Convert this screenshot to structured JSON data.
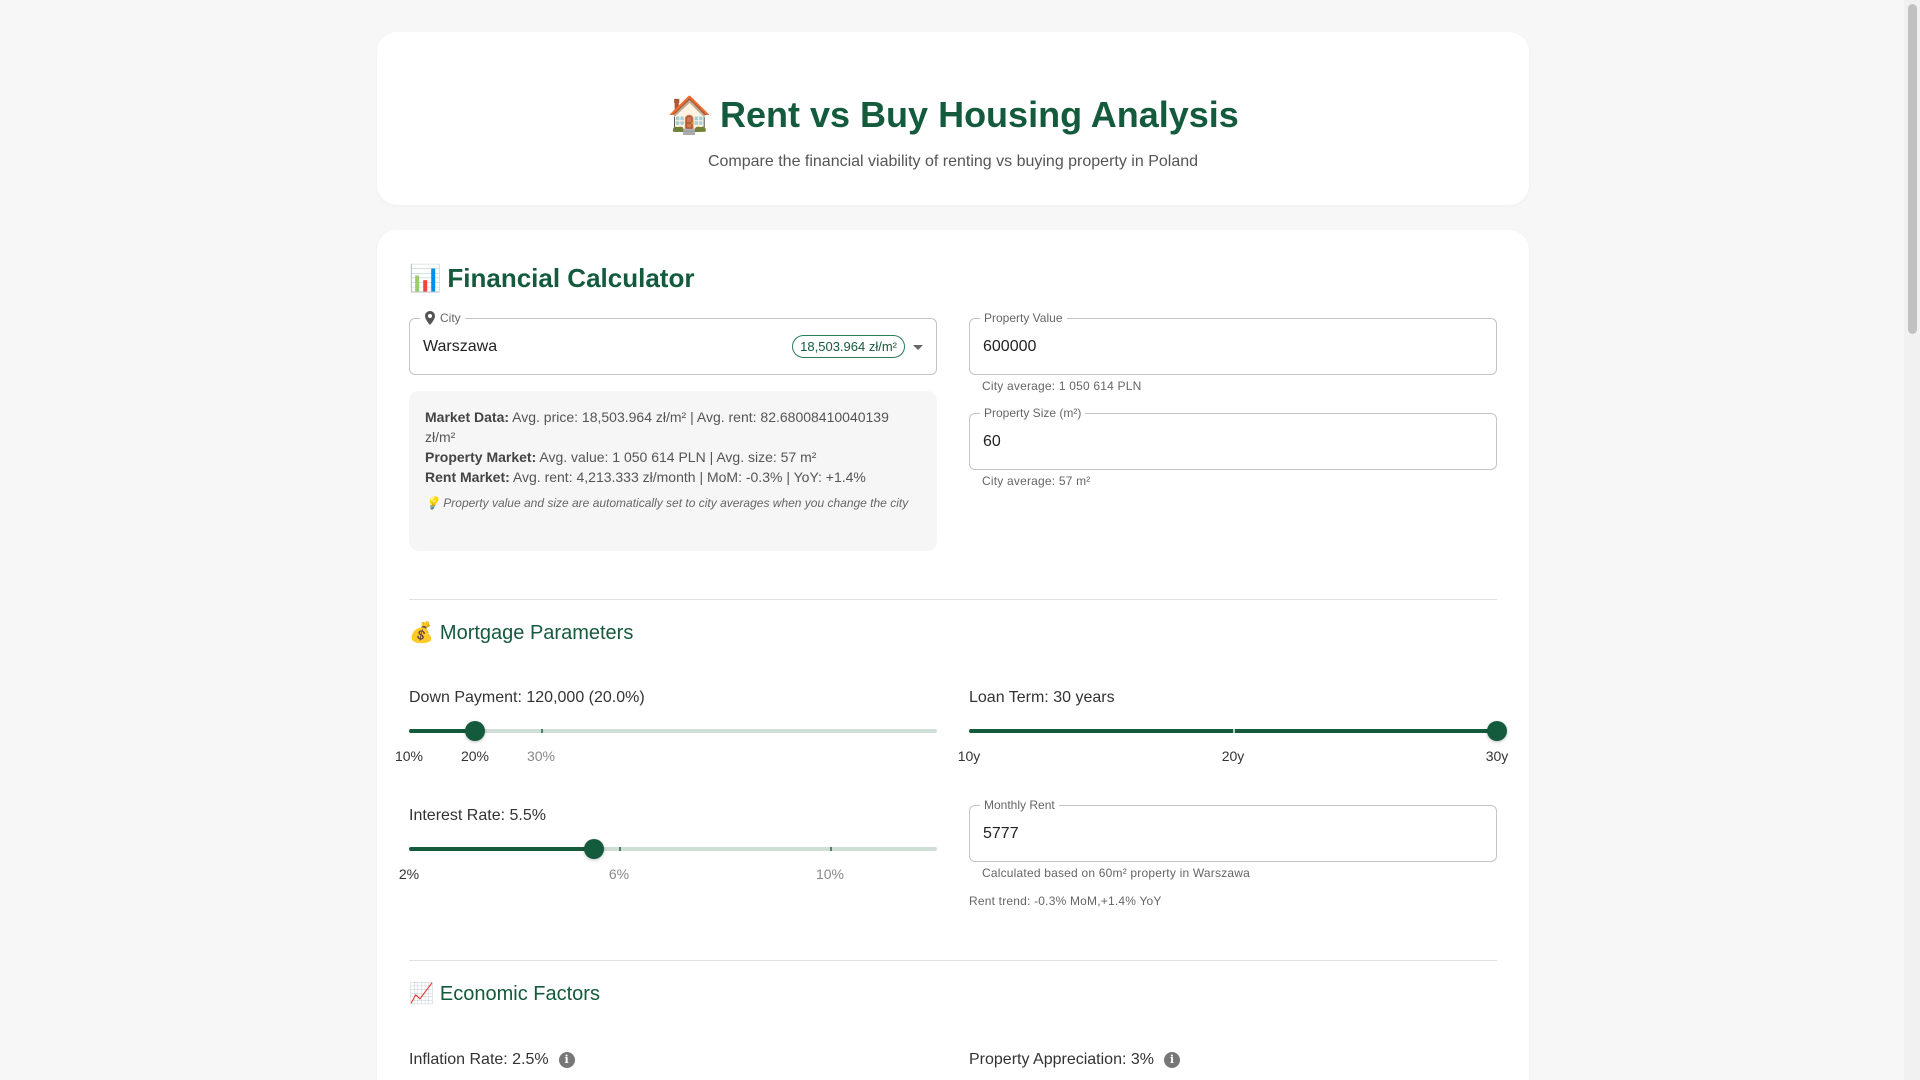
{
  "header": {
    "title_emoji": "🏠",
    "title": "Rent vs Buy Housing Analysis",
    "subtitle": "Compare the financial viability of renting vs buying property in Poland"
  },
  "calculator": {
    "title_emoji": "📊",
    "title": "Financial Calculator",
    "city": {
      "label": "City",
      "value": "Warszawa",
      "badge": "18,503.964 zł/m²"
    },
    "market": {
      "market_data_label": "Market Data:",
      "market_data_text": "Avg. price: 18,503.964 zł/m² | Avg. rent: 82.68008410040139 zł/m²",
      "property_market_label": "Property Market:",
      "property_market_text": "Avg. value: 1 050 614 PLN | Avg. size: 57 m²",
      "rent_market_label": "Rent Market:",
      "rent_market_text": "Avg. rent: 4,213.333 zł/month | MoM: -0.3% | YoY: +1.4%",
      "note": "💡 Property value and size are automatically set to city averages when you change the city"
    },
    "property_value": {
      "label": "Property Value",
      "value": "600000",
      "helper": "City average: 1 050 614 PLN"
    },
    "property_size": {
      "label": "Property Size (m²)",
      "value": "60",
      "helper": "City average: 57 m²"
    }
  },
  "mortgage": {
    "title_emoji": "💰",
    "title": "Mortgage Parameters",
    "down_payment": {
      "label": "Down Payment: 120,000 (20.0%)",
      "level_fraction": 0.125,
      "marks": [
        "10%",
        "20%",
        "30%"
      ]
    },
    "loan_term": {
      "label": "Loan Term: 30 years",
      "level_fraction": 1.0,
      "marks": [
        "10y",
        "20y",
        "30y"
      ]
    },
    "interest_rate": {
      "label": "Interest Rate: 5.5%",
      "level_fraction": 0.35,
      "marks": [
        "2%",
        "6%",
        "10%"
      ]
    },
    "monthly_rent": {
      "label": "Monthly Rent",
      "value": "5777",
      "helper": "Calculated based on 60m² property in Warszawa",
      "trend": "Rent trend: -0.3% MoM,+1.4% YoY"
    }
  },
  "economic": {
    "title_emoji": "📈",
    "title": "Economic Factors",
    "inflation_label": "Inflation Rate: 2.5%",
    "appreciation_label": "Property Appreciation: 3%",
    "info_icon": "i"
  },
  "colors": {
    "accent": "#145a3c",
    "track": "#cfded6",
    "background": "#f7f7f8"
  }
}
